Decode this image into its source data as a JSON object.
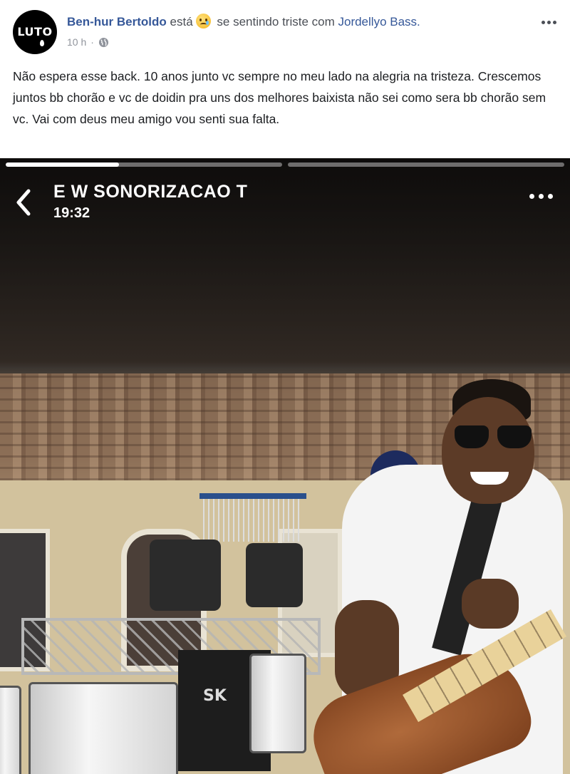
{
  "post": {
    "avatar_text": "LUTO",
    "author": "Ben-hur Bertoldo",
    "feeling_prefix": "está",
    "feeling_text": "se sentindo triste com",
    "tagged": "Jordellyo Bass.",
    "time": "10 h",
    "separator": "·",
    "privacy_icon": "globe-icon",
    "more_icon": "more-horizontal-icon",
    "caption": "Não espera esse back. 10 anos junto vc sempre no meu lado na alegria na tristeza. Crescemos juntos bb chorão e vc de doidin pra uns dos melhores baixista não sei como sera bb chorão sem vc. Vai com deus meu amigo vou senti sua falta."
  },
  "story": {
    "title": "E W SONORIZACAO T",
    "time": "19:32",
    "progress": [
      0.41,
      0.0
    ],
    "back_icon": "chevron-left-icon",
    "more_icon": "more-horizontal-icon",
    "case_text": "SK"
  },
  "colors": {
    "link": "#365899",
    "text": "#1c1e21",
    "meta": "#90949c"
  }
}
